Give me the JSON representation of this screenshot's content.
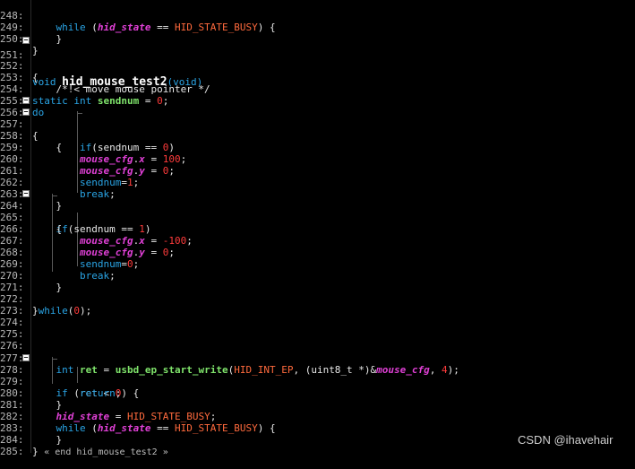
{
  "lines": [
    {
      "n": "248:",
      "code": "    while (hid_state == HID_STATE_BUSY) {"
    },
    {
      "n": "249:",
      "code": "    }"
    },
    {
      "n": "250:",
      "code": "}"
    },
    {
      "n": "251:",
      "code": "void hid_mouse_test2(void)"
    },
    {
      "n": "252:",
      "code": "{"
    },
    {
      "n": "253:",
      "code": "    /*!< move mouse pointer */"
    },
    {
      "n": "254:",
      "code": "static int sendnum = 0;"
    },
    {
      "n": "255:",
      "code": "do"
    },
    {
      "n": "256:",
      "code": "{"
    },
    {
      "n": "257:",
      "code": "        if(sendnum == 0)"
    },
    {
      "n": "258:",
      "code": "    {"
    },
    {
      "n": "259:",
      "code": "        mouse_cfg.x = 100;"
    },
    {
      "n": "260:",
      "code": "        mouse_cfg.y = 0;"
    },
    {
      "n": "261:",
      "code": "        sendnum=1;"
    },
    {
      "n": "262:",
      "code": "        break;"
    },
    {
      "n": "263:",
      "code": "    }"
    },
    {
      "n": "264:",
      "code": "    if(sendnum == 1)"
    },
    {
      "n": "265:",
      "code": "    {"
    },
    {
      "n": "266:",
      "code": "        mouse_cfg.x = -100;"
    },
    {
      "n": "267:",
      "code": "        mouse_cfg.y = 0;"
    },
    {
      "n": "268:",
      "code": "        sendnum=0;"
    },
    {
      "n": "269:",
      "code": "        break;"
    },
    {
      "n": "270:",
      "code": "    }"
    },
    {
      "n": "271:",
      "code": ""
    },
    {
      "n": "272:",
      "code": "}while(0);"
    },
    {
      "n": "273:",
      "code": ""
    },
    {
      "n": "274:",
      "code": ""
    },
    {
      "n": "275:",
      "code": ""
    },
    {
      "n": "276:",
      "code": ""
    },
    {
      "n": "277:",
      "code": "    int ret = usbd_ep_start_write(HID_INT_EP, (uint8_t *)&mouse_cfg, 4);"
    },
    {
      "n": "278:",
      "code": "    if (ret < 0) {"
    },
    {
      "n": "279:",
      "code": "        return;"
    },
    {
      "n": "280:",
      "code": "    }"
    },
    {
      "n": "281:",
      "code": "    hid_state = HID_STATE_BUSY;"
    },
    {
      "n": "282:",
      "code": "    while (hid_state == HID_STATE_BUSY) {"
    },
    {
      "n": "283:",
      "code": "    }"
    },
    {
      "n": "284:",
      "code": "} « end hid_mouse_test2 »"
    },
    {
      "n": "285:",
      "code": ""
    }
  ],
  "watermark": "CSDN @ihavehair",
  "colors": {
    "background": "#000000",
    "keyword": "#2aa5e6",
    "variable": "#7fe36b",
    "global": "#e040d6",
    "number": "#ff3b3b",
    "macro": "#ff6a3d"
  }
}
